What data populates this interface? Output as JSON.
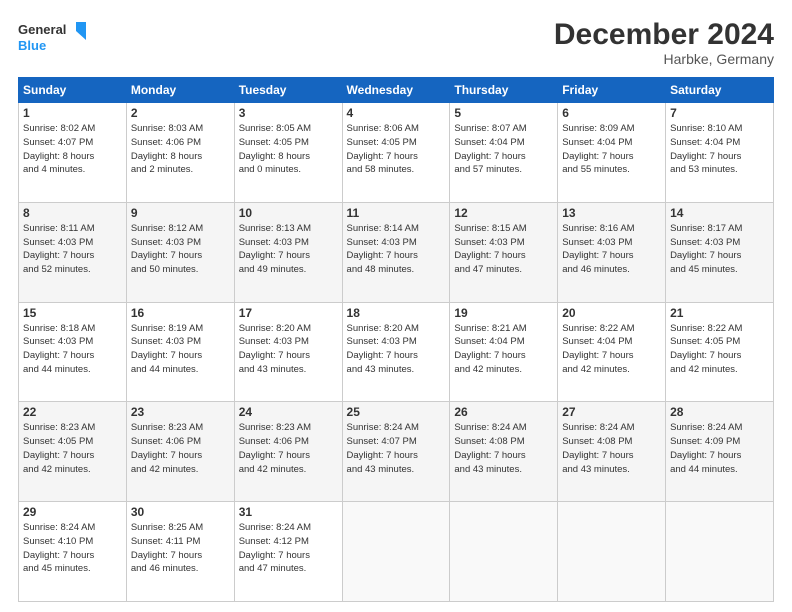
{
  "header": {
    "logo_line1": "General",
    "logo_line2": "Blue",
    "title": "December 2024",
    "subtitle": "Harbke, Germany"
  },
  "columns": [
    "Sunday",
    "Monday",
    "Tuesday",
    "Wednesday",
    "Thursday",
    "Friday",
    "Saturday"
  ],
  "weeks": [
    [
      {
        "day": 1,
        "lines": [
          "Sunrise: 8:02 AM",
          "Sunset: 4:07 PM",
          "Daylight: 8 hours",
          "and 4 minutes."
        ]
      },
      {
        "day": 2,
        "lines": [
          "Sunrise: 8:03 AM",
          "Sunset: 4:06 PM",
          "Daylight: 8 hours",
          "and 2 minutes."
        ]
      },
      {
        "day": 3,
        "lines": [
          "Sunrise: 8:05 AM",
          "Sunset: 4:05 PM",
          "Daylight: 8 hours",
          "and 0 minutes."
        ]
      },
      {
        "day": 4,
        "lines": [
          "Sunrise: 8:06 AM",
          "Sunset: 4:05 PM",
          "Daylight: 7 hours",
          "and 58 minutes."
        ]
      },
      {
        "day": 5,
        "lines": [
          "Sunrise: 8:07 AM",
          "Sunset: 4:04 PM",
          "Daylight: 7 hours",
          "and 57 minutes."
        ]
      },
      {
        "day": 6,
        "lines": [
          "Sunrise: 8:09 AM",
          "Sunset: 4:04 PM",
          "Daylight: 7 hours",
          "and 55 minutes."
        ]
      },
      {
        "day": 7,
        "lines": [
          "Sunrise: 8:10 AM",
          "Sunset: 4:04 PM",
          "Daylight: 7 hours",
          "and 53 minutes."
        ]
      }
    ],
    [
      {
        "day": 8,
        "lines": [
          "Sunrise: 8:11 AM",
          "Sunset: 4:03 PM",
          "Daylight: 7 hours",
          "and 52 minutes."
        ]
      },
      {
        "day": 9,
        "lines": [
          "Sunrise: 8:12 AM",
          "Sunset: 4:03 PM",
          "Daylight: 7 hours",
          "and 50 minutes."
        ]
      },
      {
        "day": 10,
        "lines": [
          "Sunrise: 8:13 AM",
          "Sunset: 4:03 PM",
          "Daylight: 7 hours",
          "and 49 minutes."
        ]
      },
      {
        "day": 11,
        "lines": [
          "Sunrise: 8:14 AM",
          "Sunset: 4:03 PM",
          "Daylight: 7 hours",
          "and 48 minutes."
        ]
      },
      {
        "day": 12,
        "lines": [
          "Sunrise: 8:15 AM",
          "Sunset: 4:03 PM",
          "Daylight: 7 hours",
          "and 47 minutes."
        ]
      },
      {
        "day": 13,
        "lines": [
          "Sunrise: 8:16 AM",
          "Sunset: 4:03 PM",
          "Daylight: 7 hours",
          "and 46 minutes."
        ]
      },
      {
        "day": 14,
        "lines": [
          "Sunrise: 8:17 AM",
          "Sunset: 4:03 PM",
          "Daylight: 7 hours",
          "and 45 minutes."
        ]
      }
    ],
    [
      {
        "day": 15,
        "lines": [
          "Sunrise: 8:18 AM",
          "Sunset: 4:03 PM",
          "Daylight: 7 hours",
          "and 44 minutes."
        ]
      },
      {
        "day": 16,
        "lines": [
          "Sunrise: 8:19 AM",
          "Sunset: 4:03 PM",
          "Daylight: 7 hours",
          "and 44 minutes."
        ]
      },
      {
        "day": 17,
        "lines": [
          "Sunrise: 8:20 AM",
          "Sunset: 4:03 PM",
          "Daylight: 7 hours",
          "and 43 minutes."
        ]
      },
      {
        "day": 18,
        "lines": [
          "Sunrise: 8:20 AM",
          "Sunset: 4:03 PM",
          "Daylight: 7 hours",
          "and 43 minutes."
        ]
      },
      {
        "day": 19,
        "lines": [
          "Sunrise: 8:21 AM",
          "Sunset: 4:04 PM",
          "Daylight: 7 hours",
          "and 42 minutes."
        ]
      },
      {
        "day": 20,
        "lines": [
          "Sunrise: 8:22 AM",
          "Sunset: 4:04 PM",
          "Daylight: 7 hours",
          "and 42 minutes."
        ]
      },
      {
        "day": 21,
        "lines": [
          "Sunrise: 8:22 AM",
          "Sunset: 4:05 PM",
          "Daylight: 7 hours",
          "and 42 minutes."
        ]
      }
    ],
    [
      {
        "day": 22,
        "lines": [
          "Sunrise: 8:23 AM",
          "Sunset: 4:05 PM",
          "Daylight: 7 hours",
          "and 42 minutes."
        ]
      },
      {
        "day": 23,
        "lines": [
          "Sunrise: 8:23 AM",
          "Sunset: 4:06 PM",
          "Daylight: 7 hours",
          "and 42 minutes."
        ]
      },
      {
        "day": 24,
        "lines": [
          "Sunrise: 8:23 AM",
          "Sunset: 4:06 PM",
          "Daylight: 7 hours",
          "and 42 minutes."
        ]
      },
      {
        "day": 25,
        "lines": [
          "Sunrise: 8:24 AM",
          "Sunset: 4:07 PM",
          "Daylight: 7 hours",
          "and 43 minutes."
        ]
      },
      {
        "day": 26,
        "lines": [
          "Sunrise: 8:24 AM",
          "Sunset: 4:08 PM",
          "Daylight: 7 hours",
          "and 43 minutes."
        ]
      },
      {
        "day": 27,
        "lines": [
          "Sunrise: 8:24 AM",
          "Sunset: 4:08 PM",
          "Daylight: 7 hours",
          "and 43 minutes."
        ]
      },
      {
        "day": 28,
        "lines": [
          "Sunrise: 8:24 AM",
          "Sunset: 4:09 PM",
          "Daylight: 7 hours",
          "and 44 minutes."
        ]
      }
    ],
    [
      {
        "day": 29,
        "lines": [
          "Sunrise: 8:24 AM",
          "Sunset: 4:10 PM",
          "Daylight: 7 hours",
          "and 45 minutes."
        ]
      },
      {
        "day": 30,
        "lines": [
          "Sunrise: 8:25 AM",
          "Sunset: 4:11 PM",
          "Daylight: 7 hours",
          "and 46 minutes."
        ]
      },
      {
        "day": 31,
        "lines": [
          "Sunrise: 8:24 AM",
          "Sunset: 4:12 PM",
          "Daylight: 7 hours",
          "and 47 minutes."
        ]
      },
      null,
      null,
      null,
      null
    ]
  ]
}
